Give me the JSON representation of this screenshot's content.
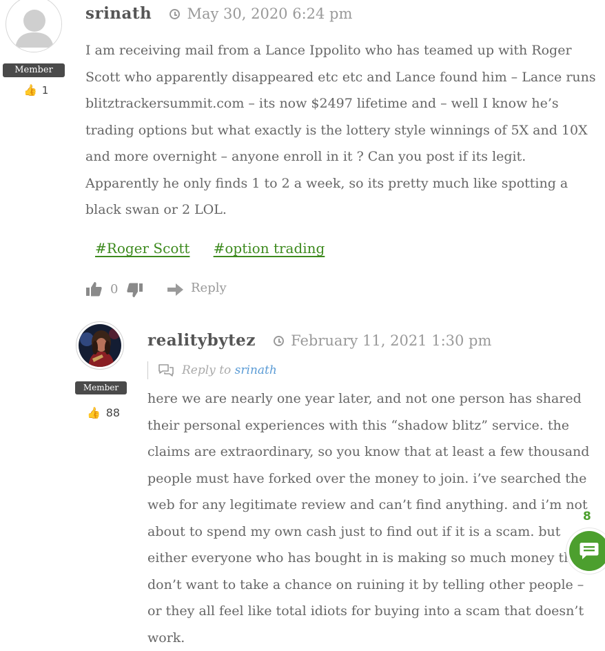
{
  "comments": [
    {
      "author": "srinath",
      "date": "May 30, 2020 6:24 pm",
      "role": "Member",
      "likes": "1",
      "text": "I am receiving mail from a Lance Ippolito who has teamed up with Roger Scott who apparently disappeared etc etc and Lance found him – Lance runs blitztrackersummit.com – its now $2497 lifetime and – well I know he’s trading options but what exactly is the lottery style winnings of 5X and 10X and more overnight – anyone enroll in it ? Can you post if its legit. Apparently he only finds 1 to 2 a week, so its pretty much like spotting a black swan or 2 LOL.",
      "tags": [
        "#Roger Scott",
        "#option trading"
      ],
      "vote_count": "0",
      "reply_label": "Reply"
    },
    {
      "author": "realitybytez",
      "date": "February 11, 2021 1:30 pm",
      "role": "Member",
      "likes": "88",
      "reply_to_label": "Reply to",
      "reply_to_user": "srinath",
      "text": "here we are nearly one year later, and not one person has shared their personal experiences with this “shadow blitz” service. the claims are extraordinary, so you know that at least a few thousand people must have forked over the money to join. i’ve searched the web for any legitimate review and can’t find anything. and i’m not about to spend my own cash just to find out if it is a scam. but either everyone who has bought in is making so much money they don’t want to take a chance on ruining it by telling other people – or they all feel like total idiots for buying into a scam that doesn’t work."
    }
  ],
  "comments_fab": {
    "count": "8",
    "icon": "chat-bubble-icon"
  },
  "colors": {
    "tag_green": "#3d8a1e",
    "fab_green": "#4c9f2e",
    "link_blue": "#5a9bd5",
    "badge": "#4a4a4a"
  }
}
